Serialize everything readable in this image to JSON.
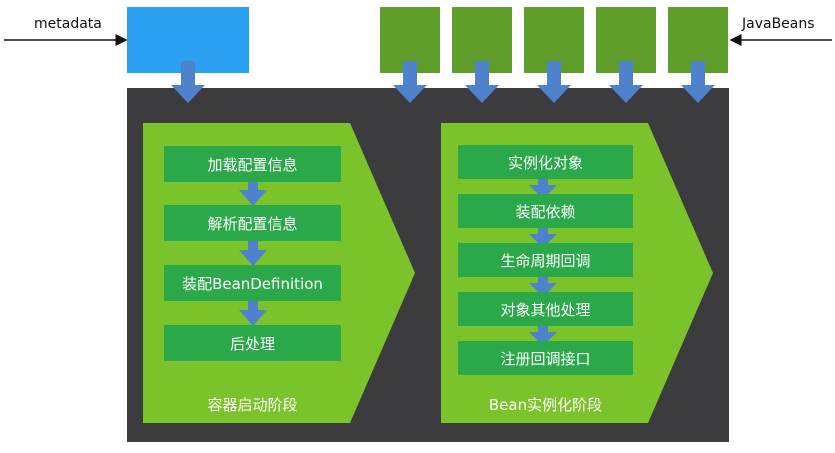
{
  "inputs": {
    "metadata": "metadata",
    "javabeans": "JavaBeans"
  },
  "phase1": {
    "label": "容器启动阶段",
    "steps": [
      "加载配置信息",
      "解析配置信息",
      "装配BeanDefinition",
      "后处理"
    ]
  },
  "phase2": {
    "label": "Bean实例化阶段",
    "steps": [
      "实例化对象",
      "装配依赖",
      "生命周期回调",
      "对象其他处理",
      "注册回调接口"
    ]
  },
  "colors": {
    "panel": "#3c3c3e",
    "phase_arrow": "#7ac32a",
    "step": "#2aa84a",
    "connector": "#4f82cc",
    "metadata_box": "#2b9ff0",
    "bean_box": "#5f9d2a"
  }
}
